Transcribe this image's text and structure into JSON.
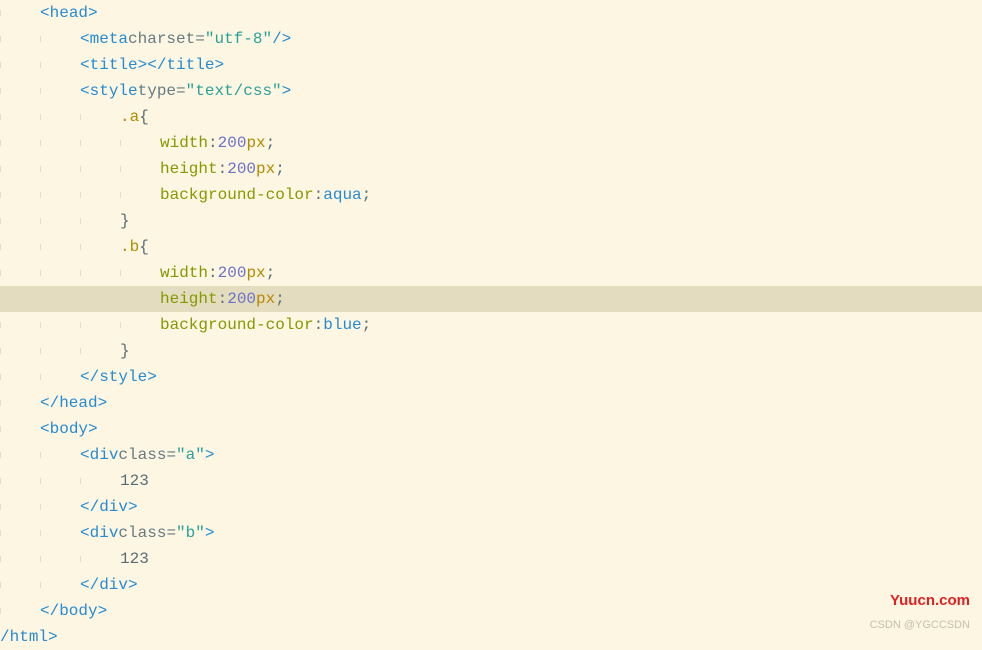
{
  "code": {
    "lines": [
      {
        "indent": 1,
        "type": "tag-open",
        "tag": "head",
        "selfclose": false
      },
      {
        "indent": 2,
        "type": "tag-selfclose",
        "tag": "meta",
        "attrs": [
          {
            "name": "charset",
            "value": "utf-8"
          }
        ]
      },
      {
        "indent": 2,
        "type": "tag-empty",
        "tag": "title"
      },
      {
        "indent": 2,
        "type": "tag-open",
        "tag": "style",
        "attrs": [
          {
            "name": "type",
            "value": "text/css"
          }
        ]
      },
      {
        "indent": 3,
        "type": "css-selector-open",
        "selector": ".a"
      },
      {
        "indent": 4,
        "type": "css-decl",
        "property": "width",
        "value_num": "200",
        "value_unit": "px"
      },
      {
        "indent": 4,
        "type": "css-decl",
        "property": "height",
        "value_num": "200",
        "value_unit": "px"
      },
      {
        "indent": 4,
        "type": "css-decl",
        "property": "background-color",
        "value_kw": "aqua"
      },
      {
        "indent": 3,
        "type": "css-close"
      },
      {
        "indent": 3,
        "type": "css-selector-open",
        "selector": ".b"
      },
      {
        "indent": 4,
        "type": "css-decl",
        "property": "width",
        "value_num": "200",
        "value_unit": "px"
      },
      {
        "indent": 4,
        "type": "css-decl",
        "property": "height",
        "value_num": "200",
        "value_unit": "px",
        "highlight": true
      },
      {
        "indent": 4,
        "type": "css-decl",
        "property": "background-color",
        "value_kw": "blue"
      },
      {
        "indent": 3,
        "type": "css-close"
      },
      {
        "indent": 2,
        "type": "tag-close",
        "tag": "style"
      },
      {
        "indent": 1,
        "type": "tag-close",
        "tag": "head"
      },
      {
        "indent": 1,
        "type": "tag-open",
        "tag": "body"
      },
      {
        "indent": 2,
        "type": "tag-open",
        "tag": "div",
        "attrs": [
          {
            "name": "class",
            "value": "a"
          }
        ]
      },
      {
        "indent": 3,
        "type": "text",
        "text": "123"
      },
      {
        "indent": 2,
        "type": "tag-close",
        "tag": "div"
      },
      {
        "indent": 2,
        "type": "tag-open",
        "tag": "div",
        "attrs": [
          {
            "name": "class",
            "value": "b"
          }
        ]
      },
      {
        "indent": 3,
        "type": "text",
        "text": "123"
      },
      {
        "indent": 2,
        "type": "tag-close",
        "tag": "div"
      },
      {
        "indent": 1,
        "type": "tag-close",
        "tag": "body"
      },
      {
        "indent": 0,
        "type": "tag-close-partial",
        "tag": "html"
      }
    ]
  },
  "watermarks": {
    "brand": "Yuucn.com",
    "attribution": "CSDN @YGCCSDN"
  }
}
